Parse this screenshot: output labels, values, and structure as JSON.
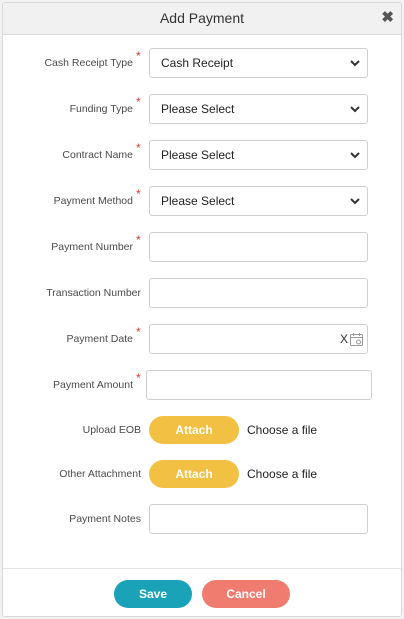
{
  "dialog": {
    "title": "Add Payment",
    "close_label": "✖"
  },
  "form": {
    "required_marker": "*",
    "cash_receipt_type": {
      "label": "Cash Receipt Type",
      "value": "Cash Receipt"
    },
    "funding_type": {
      "label": "Funding Type",
      "value": "Please Select"
    },
    "contract_name": {
      "label": "Contract Name",
      "value": "Please Select"
    },
    "payment_method": {
      "label": "Payment Method",
      "value": "Please Select"
    },
    "payment_number": {
      "label": "Payment Number",
      "value": ""
    },
    "transaction_number": {
      "label": "Transaction Number",
      "value": ""
    },
    "payment_date": {
      "label": "Payment Date",
      "value": "",
      "clear_label": "X"
    },
    "payment_amount": {
      "label": "Payment Amount",
      "value": ""
    },
    "upload_eob": {
      "label": "Upload EOB",
      "button_label": "Attach",
      "file_text": "Choose a file"
    },
    "other_attachment": {
      "label": "Other Attachment",
      "button_label": "Attach",
      "file_text": "Choose a file"
    },
    "payment_notes": {
      "label": "Payment Notes",
      "value": ""
    }
  },
  "footer": {
    "save_label": "Save",
    "cancel_label": "Cancel"
  },
  "colors": {
    "attach_button": "#f2c043",
    "save_button": "#1aa2b8",
    "cancel_button": "#f07c70",
    "required_marker": "#e53935"
  }
}
